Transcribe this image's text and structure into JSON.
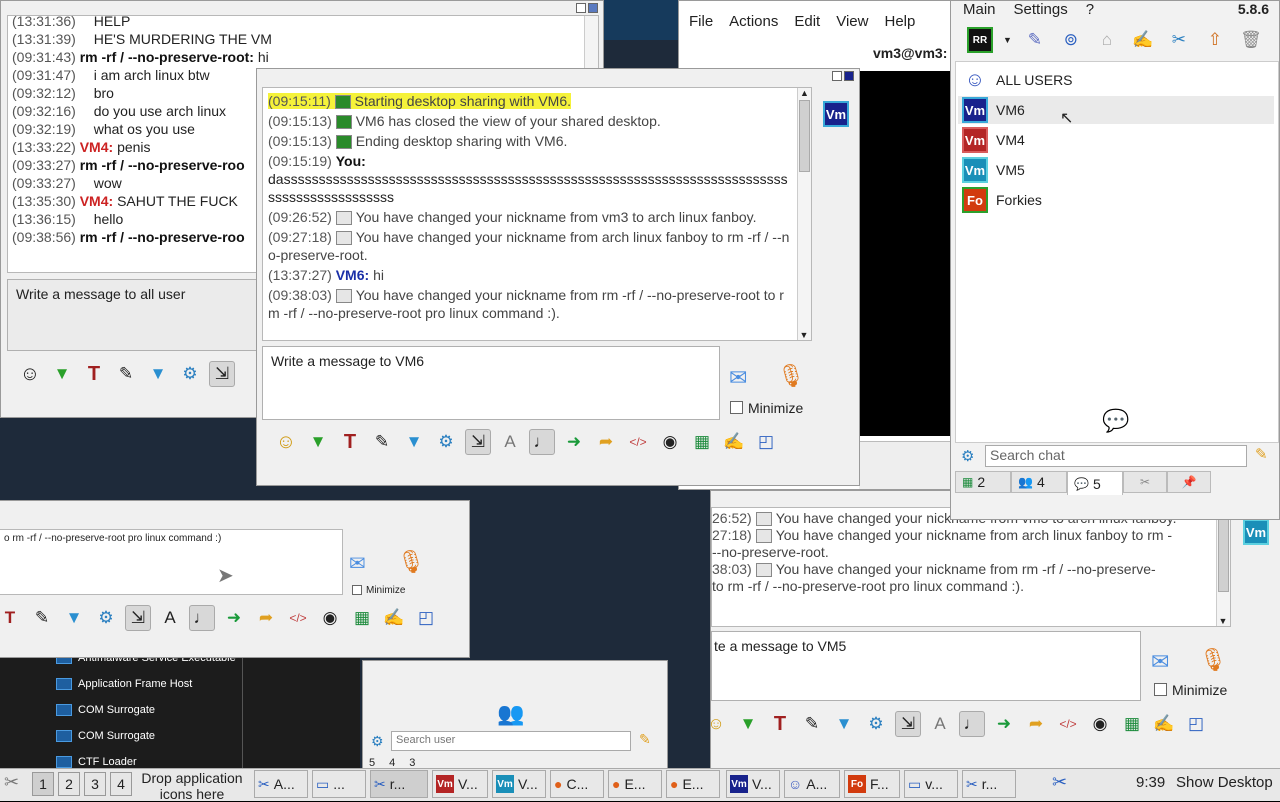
{
  "colors": {
    "accent": "#18228c",
    "highlight": "#f5f23a",
    "red_nick": "#cc2222",
    "blue_nick": "#1a2fa8"
  },
  "main_chat": {
    "log": [
      {
        "ts": "(13:31:36)",
        "nick": "",
        "text": "HELP"
      },
      {
        "ts": "(13:31:39)",
        "nick": "",
        "text": "HE'S MURDERING THE VM"
      },
      {
        "ts": "(09:31:43)",
        "nick": "rm -rf / --no-preserve-root:",
        "text": "hi"
      },
      {
        "ts": "(09:31:47)",
        "nick": "",
        "text": "i am arch linux btw"
      },
      {
        "ts": "(09:32:12)",
        "nick": "",
        "text": "bro"
      },
      {
        "ts": "(09:32:16)",
        "nick": "",
        "text": "do you use arch linux"
      },
      {
        "ts": "(09:32:19)",
        "nick": "",
        "text": "what os you use"
      },
      {
        "ts": "(13:33:22)",
        "nick": "VM4:",
        "text": "penis"
      },
      {
        "ts": "(09:33:27)",
        "nick": "rm -rf / --no-preserve-roo",
        "text": ""
      },
      {
        "ts": "(09:33:27)",
        "nick": "",
        "text": "wow"
      },
      {
        "ts": "(13:35:30)",
        "nick": "VM4:",
        "text": "SAHUT THE FUCK"
      },
      {
        "ts": "(13:36:15)",
        "nick": "",
        "text": "hello"
      },
      {
        "ts": "(09:38:56)",
        "nick": "rm -rf / --no-preserve-roo",
        "text": ""
      }
    ],
    "input_placeholder": "Write a message to all user"
  },
  "vm6_chat": {
    "log": [
      {
        "ts": "(09:15:11)",
        "text": "Starting desktop sharing with VM6."
      },
      {
        "ts": "(09:15:13)",
        "text": "VM6 has closed the view of your shared desktop."
      },
      {
        "ts": "(09:15:13)",
        "text": "Ending desktop sharing with VM6."
      },
      {
        "ts": "(09:15:19)",
        "nick": "You:",
        "text": "dassssssssssssssssssssssssssssssssssssssssssssssssssssssssssssssssssssssssssssssssssssssssss"
      },
      {
        "ts": "(09:26:52)",
        "text": "You have changed your nickname from vm3 to arch linux fanboy."
      },
      {
        "ts": "(09:27:18)",
        "text": "You have changed your nickname from arch linux fanboy to rm -rf / --no-preserve-root."
      },
      {
        "ts": "(13:37:27)",
        "nick": "VM6:",
        "text": "hi"
      },
      {
        "ts": "(09:38:03)",
        "text": "You have changed your nickname from rm -rf / --no-preserve-root to rm -rf / --no-preserve-root pro linux command :)."
      }
    ],
    "input_placeholder": "Write a message to VM6",
    "minimize_label": "Minimize",
    "avatar_label": "Vm"
  },
  "vm5_chat": {
    "log": [
      {
        "ts": "26:52)",
        "text": "You have changed your nickname from vm3 to arch linux fanboy."
      },
      {
        "ts": "27:18)",
        "text": "You have changed your nickname from arch linux fanboy to rm -"
      },
      {
        "ts": "",
        "text": "--no-preserve-root."
      },
      {
        "ts": "38:03)",
        "text": "You have changed your nickname from rm -rf / --no-preserve-"
      },
      {
        "ts": "",
        "text": "to rm -rf / --no-preserve-root pro linux command :)."
      }
    ],
    "input_placeholder": "te a message to VM5",
    "minimize_label": "Minimize",
    "avatar_label": "Vm"
  },
  "bg_chat": {
    "log_tail": "o rm -rf / --no-preserve-root pro linux command :)",
    "minimize_label": "Minimize",
    "search_placeholder": "Search user",
    "tabs": [
      "5",
      "4",
      "3",
      "",
      ""
    ]
  },
  "remote_menu": [
    "File",
    "Actions",
    "Edit",
    "View",
    "Help"
  ],
  "remote_title": "vm3@vm3:",
  "process_list": [
    "Antimalware Service Executable",
    "Application Frame Host",
    "COM Surrogate",
    "COM Surrogate",
    "CTF Loader"
  ],
  "users_panel": {
    "menu": [
      "Main",
      "Settings",
      "?"
    ],
    "version": "5.8.6",
    "toolbar_badge": "RR",
    "users": [
      {
        "label": "ALL USERS",
        "avatar": ""
      },
      {
        "label": "VM6",
        "avatar": "Vm"
      },
      {
        "label": "VM4",
        "avatar": "Vm"
      },
      {
        "label": "VM5",
        "avatar": "Vm"
      },
      {
        "label": "Forkies",
        "avatar": "Fo"
      }
    ],
    "search_placeholder": "Search chat",
    "tabs": [
      {
        "label": "2"
      },
      {
        "label": "4"
      },
      {
        "label": "5"
      },
      {
        "label": ""
      },
      {
        "label": ""
      }
    ]
  },
  "taskbar": {
    "workspaces": [
      "1",
      "2",
      "3",
      "4"
    ],
    "drop_hint": "Drop application icons here",
    "buttons": [
      "A...",
      "...",
      "r...",
      "V...",
      "V...",
      "C...",
      "E...",
      "E...",
      "V...",
      "A...",
      "F...",
      "v...",
      "r..."
    ],
    "clock": "9:39",
    "show_desktop": "Show Desktop"
  }
}
